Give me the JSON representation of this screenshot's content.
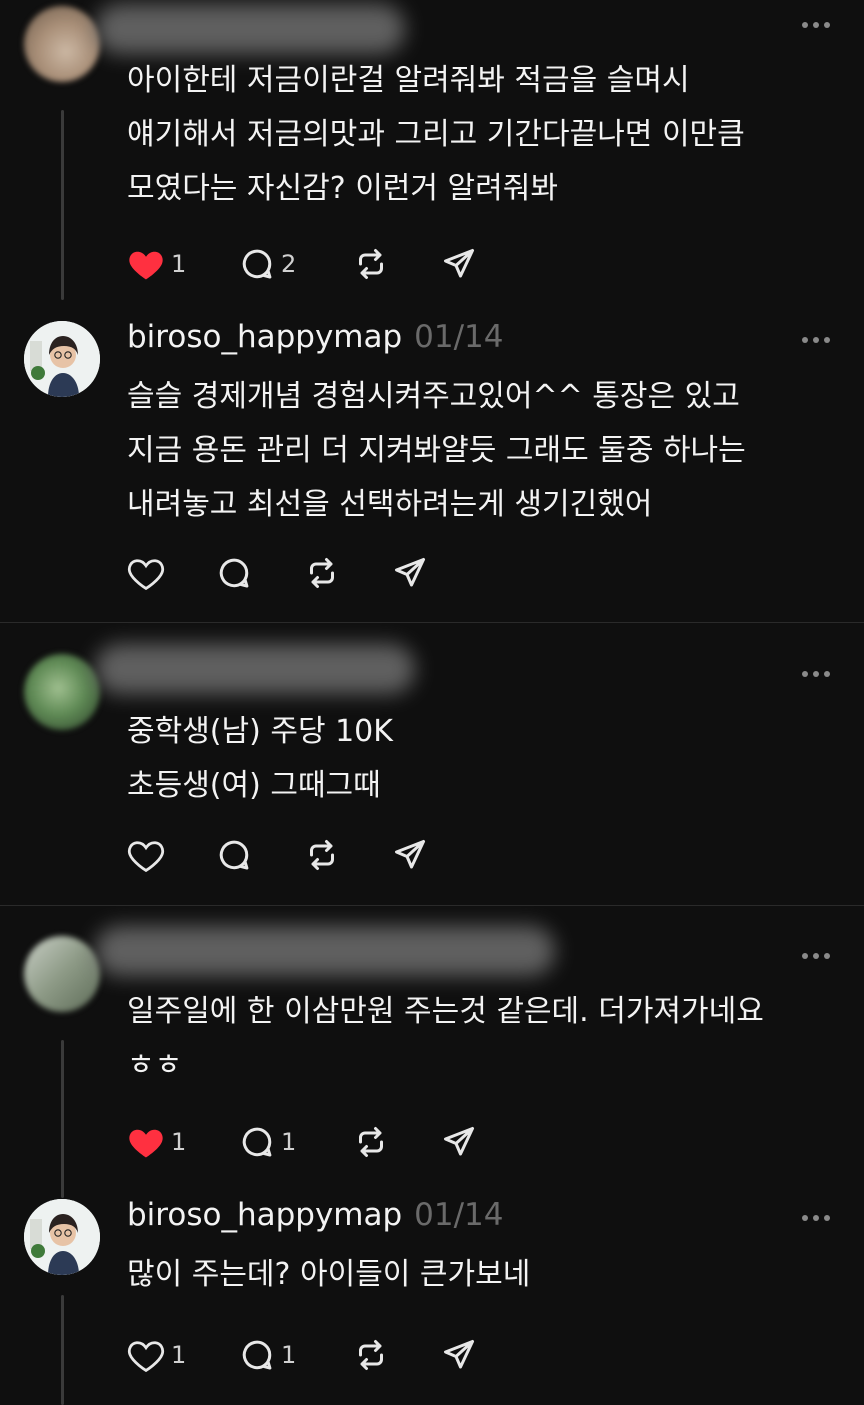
{
  "colors": {
    "background": "#0f0f0f",
    "text": "#f3f3f3",
    "muted": "#6a6a6a",
    "like_active": "#ff3040",
    "icon": "#e8e8e8"
  },
  "posts": [
    {
      "author": "",
      "date": "",
      "text": "아이한테 저금이란걸 알려줘봐 적금을 슬며시\n얘기해서 저금의맛과 그리고 기간다끝나면 이만큼\n모였다는 자신감? 이런거 알려줘봐",
      "likes": "1",
      "replies": "2",
      "liked": true
    },
    {
      "author": "biroso_happymap",
      "date": "01/14",
      "text": "슬슬 경제개념 경험시켜주고있어^^ 통장은 있고\n지금 용돈 관리 더 지켜봐얄듯 그래도 둘중 하나는\n내려놓고 최선을 선택하려는게 생기긴했어",
      "likes": "",
      "replies": "",
      "liked": false
    },
    {
      "author": "",
      "date": "",
      "text": "중학생(남) 주당 10K\n초등생(여) 그때그때",
      "likes": "",
      "replies": "",
      "liked": false
    },
    {
      "author": "",
      "date": "",
      "text": "일주일에 한 이삼만원 주는것 같은데. 더가져가네요\nㅎㅎ",
      "likes": "1",
      "replies": "1",
      "liked": true
    },
    {
      "author": "biroso_happymap",
      "date": "01/14",
      "text": "많이 주는데? 아이들이 큰가보네",
      "likes": "1",
      "replies": "1",
      "liked": false
    }
  ],
  "icons": [
    "more-icon",
    "heart-icon",
    "comment-icon",
    "repost-icon",
    "share-icon"
  ]
}
